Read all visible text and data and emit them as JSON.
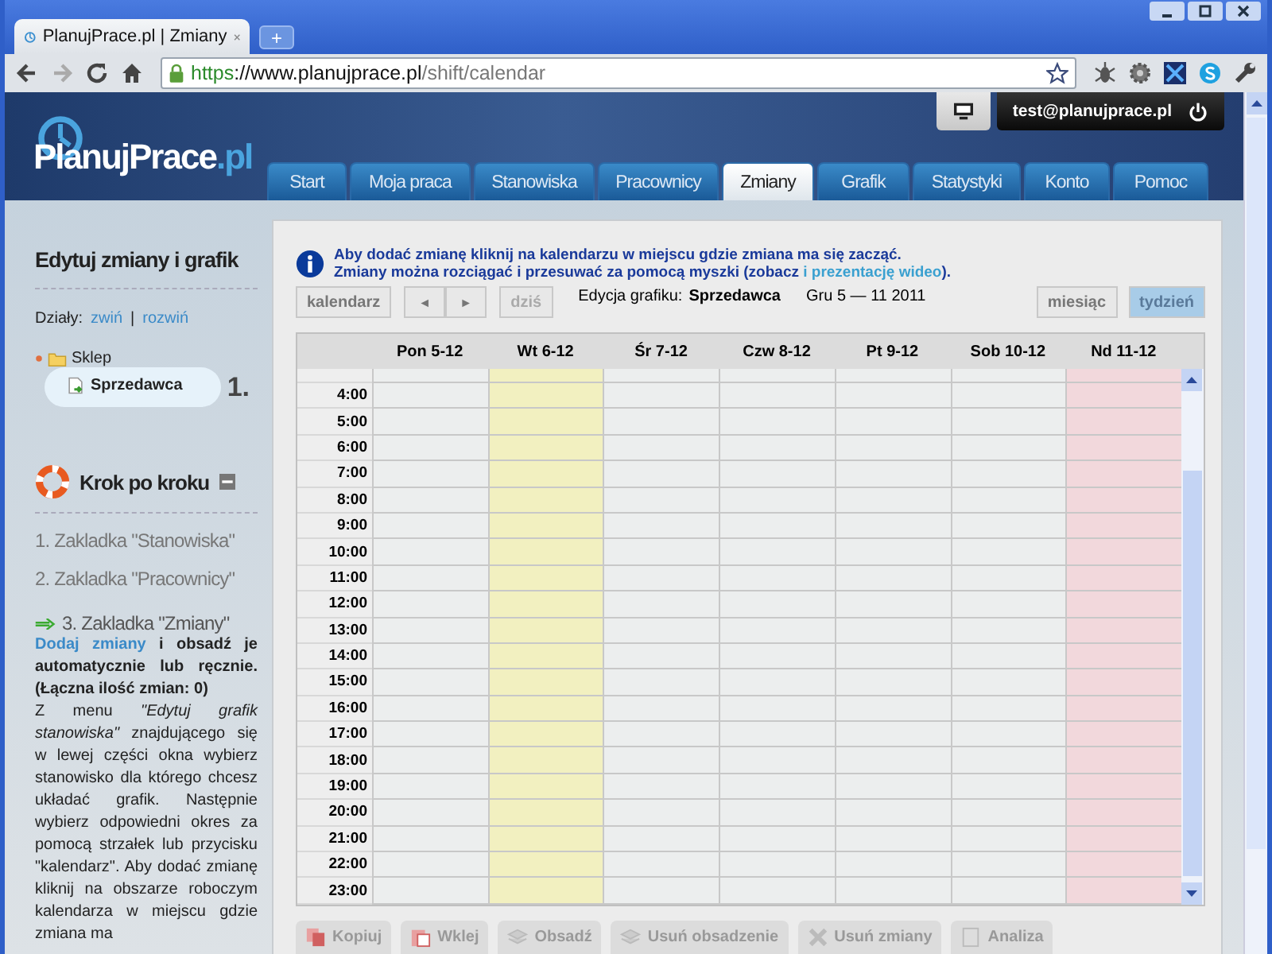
{
  "browser": {
    "tab_title": "PlanujPrace.pl | Zmiany",
    "new_tab": "+",
    "url": {
      "scheme": "https",
      "host": "://www.planujprace.pl",
      "path": "/shift/calendar"
    }
  },
  "header": {
    "logo": {
      "main": "PlanujPrace",
      "suffix": ".pl"
    },
    "user_email": "test@planujprace.pl"
  },
  "nav_tabs": [
    {
      "label": "Start",
      "selected": false
    },
    {
      "label": "Moja praca",
      "selected": false
    },
    {
      "label": "Stanowiska",
      "selected": false
    },
    {
      "label": "Pracownicy",
      "selected": false
    },
    {
      "label": "Zmiany",
      "selected": true
    },
    {
      "label": "Grafik",
      "selected": false
    },
    {
      "label": "Statystyki",
      "selected": false
    },
    {
      "label": "Konto",
      "selected": false
    },
    {
      "label": "Pomoc",
      "selected": false
    }
  ],
  "sidebar": {
    "title": "Edytuj zmiany i grafik",
    "departments_label": "Działy:",
    "collapse_link": "zwiń",
    "separator": "|",
    "expand_link": "rozwiń",
    "tree": [
      {
        "label": "Sklep",
        "expanded": true,
        "children": [
          {
            "label": "Sprzedawca",
            "selected": true
          }
        ]
      }
    ],
    "step_marker": "1.",
    "guide_title": "Krok po kroku",
    "steps": [
      {
        "label": "1. Zakladka \"Stanowiska\"",
        "active": false
      },
      {
        "label": "2. Zakladka \"Pracownicy\"",
        "active": false
      },
      {
        "label": "3. Zakladka \"Zmiany\"",
        "active": true
      }
    ],
    "step_link": "Dodaj zmiany",
    "step_intro": "i obsadź je automatycznie lub ręcznie. (Łączna ilość zmian: 0)",
    "step_body": "Z menu *\"Edytuj grafik stanowiska\"* znajdującego się w lewej części okna wybierz stanowisko dla którego chcesz układać grafik. Następnie wybierz odpowiedni okres za pomocą strzałek lub przycisku \"kalendarz\". Aby dodać zmianę kliknij na obszarze roboczym kalendarza w miejscu gdzie zmiana ma"
  },
  "info": {
    "line_1": "Aby dodać zmianę kliknij na kalendarzu w miejscu gdzie zmiana ma się zacząć.",
    "line_2_before": "Zmiany można rozciągać i przesuwać za pomocą myszki (zobacz",
    "line_2_link": "i prezentację wideo",
    "line_2_after": ")."
  },
  "toolbar": {
    "calendar_button": "kalendarz",
    "prev": "◄",
    "next": "►",
    "today": {
      "label": "dziś",
      "disabled": true
    },
    "edition_label": "Edycja grafiku:",
    "edition_value": "Sprzedawca",
    "date_range": "Gru 5 — 11 2011",
    "views": [
      {
        "label": "miesiąc",
        "selected": false
      },
      {
        "label": "tydzień",
        "selected": true
      }
    ]
  },
  "calendar": {
    "days": [
      {
        "label": "Pon 5-12",
        "kind": "weekday"
      },
      {
        "label": "Wt 6-12",
        "kind": "today"
      },
      {
        "label": "Śr 7-12",
        "kind": "weekday"
      },
      {
        "label": "Czw 8-12",
        "kind": "weekday"
      },
      {
        "label": "Pt 9-12",
        "kind": "weekday"
      },
      {
        "label": "Sob 10-12",
        "kind": "weekday"
      },
      {
        "label": "Nd 11-12",
        "kind": "sunday"
      }
    ],
    "hours": [
      "4:00",
      "5:00",
      "6:00",
      "7:00",
      "8:00",
      "9:00",
      "10:00",
      "11:00",
      "12:00",
      "13:00",
      "14:00",
      "15:00",
      "16:00",
      "17:00",
      "18:00",
      "19:00",
      "20:00",
      "21:00",
      "22:00",
      "23:00"
    ]
  },
  "actions": [
    {
      "label": "Kopiuj",
      "kind": "copy",
      "disabled": true
    },
    {
      "label": "Wklej",
      "kind": "paste",
      "disabled": true
    },
    {
      "label": "Obsadź",
      "kind": "staff",
      "disabled": true
    },
    {
      "label": "Usuń obsadzenie",
      "kind": "staff",
      "disabled": true
    },
    {
      "label": "Usuń zmiany",
      "kind": "delete",
      "disabled": true
    },
    {
      "label": "Analiza",
      "kind": "analysis",
      "disabled": true
    }
  ]
}
